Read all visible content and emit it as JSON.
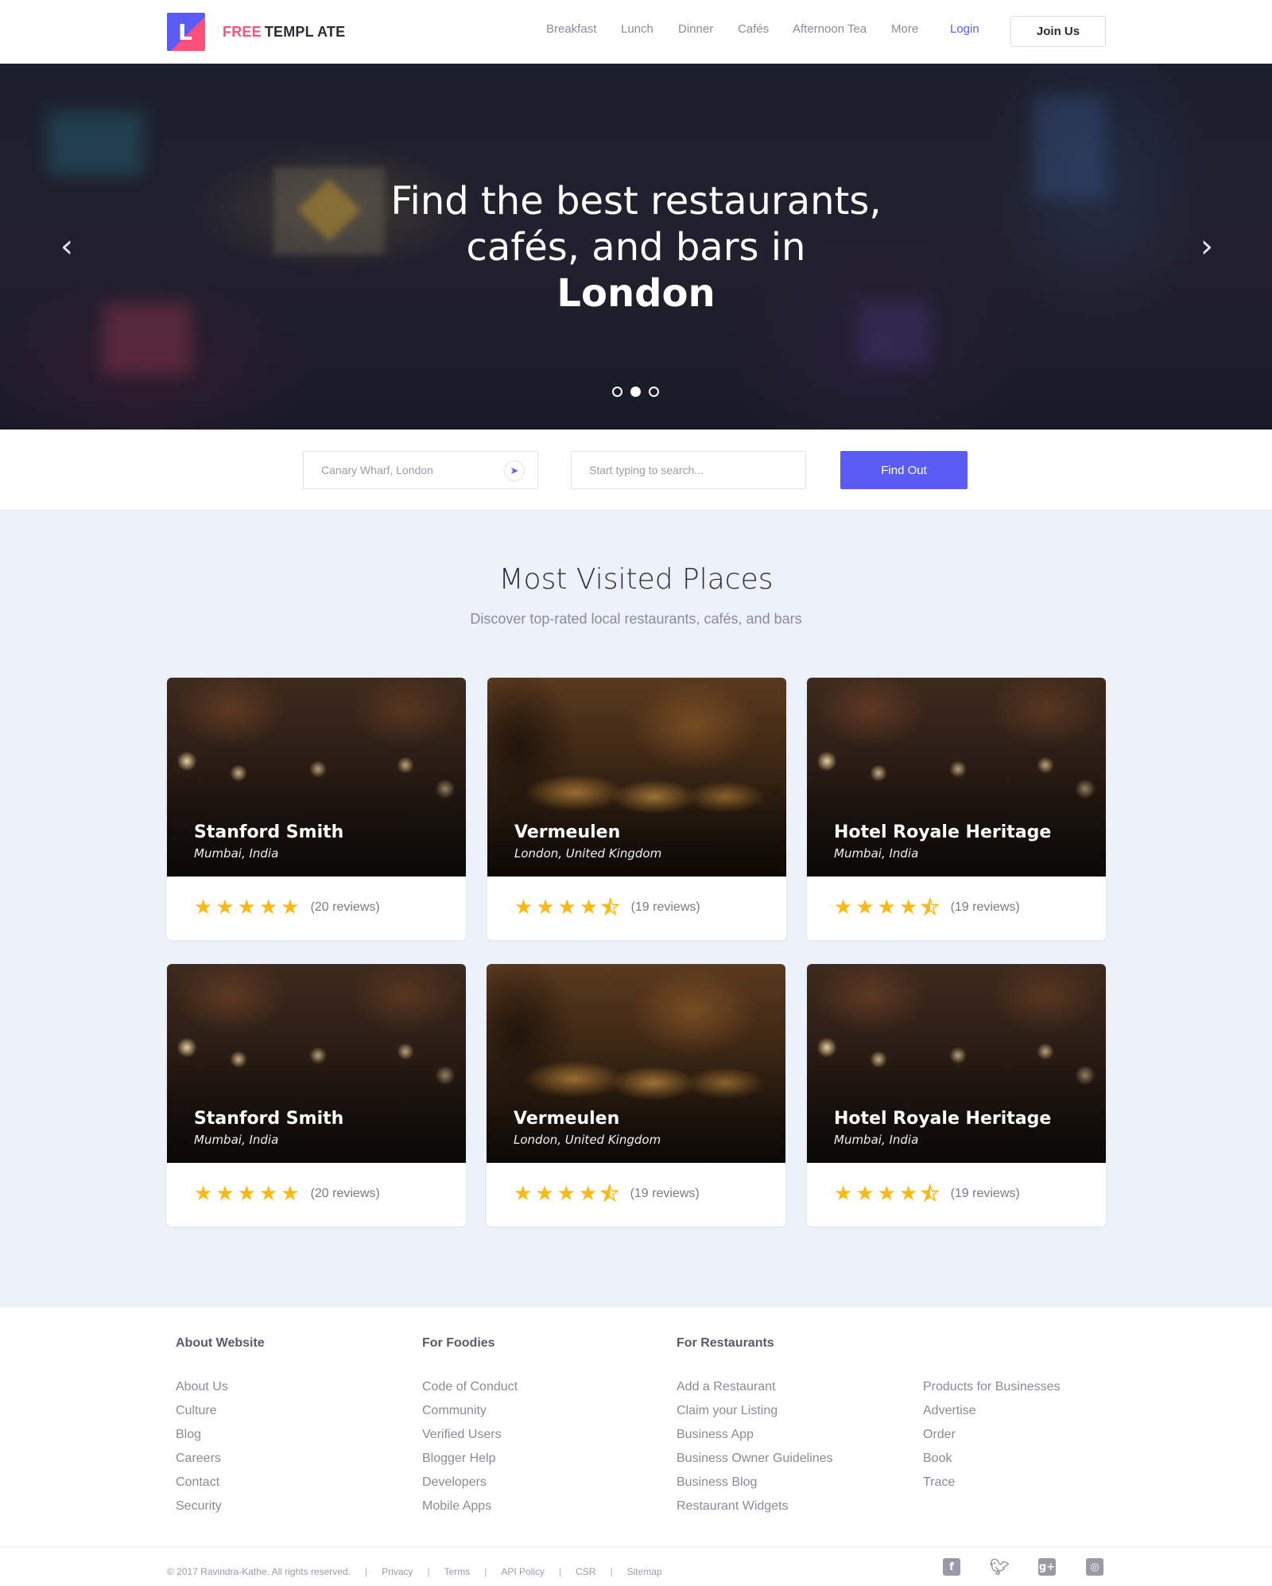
{
  "header": {
    "logo_letter": "L",
    "logo_free": "FREE",
    "logo_template": "TEMPL ATE",
    "nav": [
      "Breakfast",
      "Lunch",
      "Dinner",
      "Cafés",
      "Afternoon Tea",
      "More"
    ],
    "login": "Login",
    "join": "Join Us"
  },
  "hero": {
    "line1": "Find the best restaurants,",
    "line2": "cafés, and bars in",
    "line3": "London",
    "prev_icon": "chevron-left-icon",
    "next_icon": "chevron-right-icon",
    "slides": 3,
    "active_slide": 2
  },
  "search": {
    "location_placeholder": "Canary Wharf, London",
    "query_placeholder": "Start typing to search...",
    "button": "Find Out",
    "locate_icon": "navigation-arrow-icon"
  },
  "places": {
    "title": "Most Visited Places",
    "subtitle": "Discover top-rated local restaurants, cafés, and bars",
    "cards": [
      {
        "name": "Stanford Smith",
        "location": "Mumbai, India",
        "rating": 5,
        "reviews": "(20 reviews)"
      },
      {
        "name": "Vermeulen",
        "location": "London, United Kingdom",
        "rating": 4.5,
        "reviews": "(19 reviews)"
      },
      {
        "name": "Hotel Royale Heritage",
        "location": "Mumbai, India",
        "rating": 4.5,
        "reviews": "(19 reviews)"
      },
      {
        "name": "Stanford Smith",
        "location": "Mumbai, India",
        "rating": 5,
        "reviews": "(20 reviews)"
      },
      {
        "name": "Vermeulen",
        "location": "London, United Kingdom",
        "rating": 4.5,
        "reviews": "(19 reviews)"
      },
      {
        "name": "Hotel Royale Heritage",
        "location": "Mumbai, India",
        "rating": 4.5,
        "reviews": "(19 reviews)"
      }
    ]
  },
  "footer": {
    "columns": [
      {
        "heading": "About Website",
        "links": [
          "About Us",
          "Culture",
          "Blog",
          "Careers",
          "Contact",
          "Security"
        ]
      },
      {
        "heading": "For Foodies",
        "links": [
          "Code of Conduct",
          "Community",
          "Verified Users",
          "Blogger Help",
          "Developers",
          "Mobile Apps"
        ]
      },
      {
        "heading": "For Restaurants",
        "links": [
          "Add a Restaurant",
          "Claim your Listing",
          "Business App",
          "Business Owner Guidelines",
          "Business Blog",
          "Restaurant Widgets"
        ]
      },
      {
        "heading": "",
        "links": [
          "Products for Businesses",
          "Advertise",
          "Order",
          "Book",
          "Trace"
        ]
      }
    ],
    "copyright": "© 2017 Ravindra-Kathe. All rights reserved.",
    "legal": [
      "Privacy",
      "Terms",
      "API Policy",
      "CSR",
      "Sitemap"
    ],
    "socials": [
      "facebook-icon",
      "twitter-icon",
      "google-plus-icon",
      "instagram-icon"
    ]
  },
  "colors": {
    "accent": "#5b5bf5",
    "brand_pink": "#ff4f7b",
    "star": "#fdb813",
    "section_bg": "#edf1fa"
  }
}
